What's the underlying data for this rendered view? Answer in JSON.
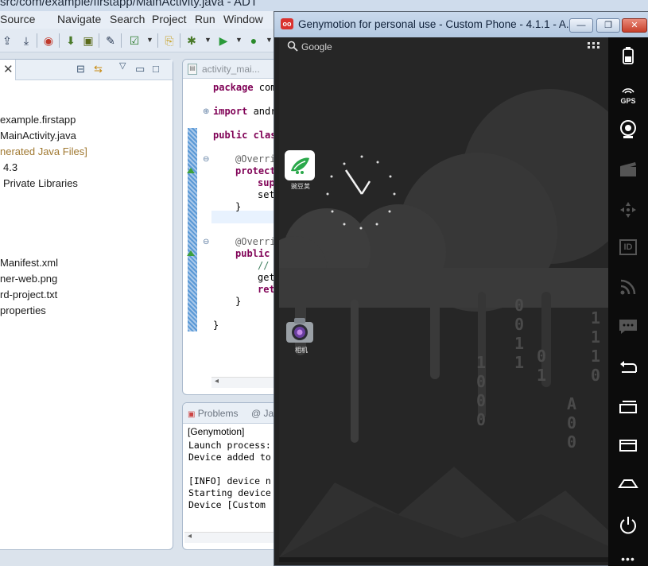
{
  "adt": {
    "title": "src/com/example/firstapp/MainActivity.java - ADT",
    "menu": [
      "Source",
      "Navigate",
      "Search",
      "Project",
      "Run",
      "Window"
    ],
    "package_explorer": {
      "tree": [
        "example.firstapp",
        "MainActivity.java",
        "nerated Java Files]",
        "4.3",
        "Private Libraries",
        "Manifest.xml",
        "ner-web.png",
        "rd-project.txt",
        "properties"
      ]
    },
    "editor": {
      "tab_label": "activity_mai...",
      "lines": {
        "package": "package",
        "package_rest": " com",
        "import": "import",
        "import_rest": " andr",
        "public": "public",
        "class_kw": " clas",
        "override1": "@Overri",
        "protected": "protect",
        "sup": "sup",
        "set": "set",
        "brace1": "}",
        "override2": "@Overri",
        "public2": "public",
        "comment": "//",
        "get": "get",
        "ret": "ret",
        "brace2": "}",
        "brace3": "}"
      }
    },
    "console": {
      "tab_problems": "Problems",
      "tab_javadoc": "@ Ja",
      "header": "[Genymotion]",
      "lines": [
        "Launch process:",
        "Device added to",
        "",
        "[INFO] device n",
        "Starting device",
        "Device [Custom "
      ]
    }
  },
  "genymotion": {
    "title": "Genymotion for personal use - Custom Phone - 4.1.1 - A...",
    "logo_text": "oo",
    "minimize": "—",
    "maximize": "❐",
    "close": "✕",
    "screen": {
      "search_text": "Google",
      "apps": [
        {
          "label": "豌豆荚",
          "icon": "wandoujia-icon"
        },
        {
          "label": "相机",
          "icon": "camera-icon"
        }
      ]
    },
    "sidebar": {
      "gps_label": "GPS",
      "id_label": "ID"
    }
  }
}
